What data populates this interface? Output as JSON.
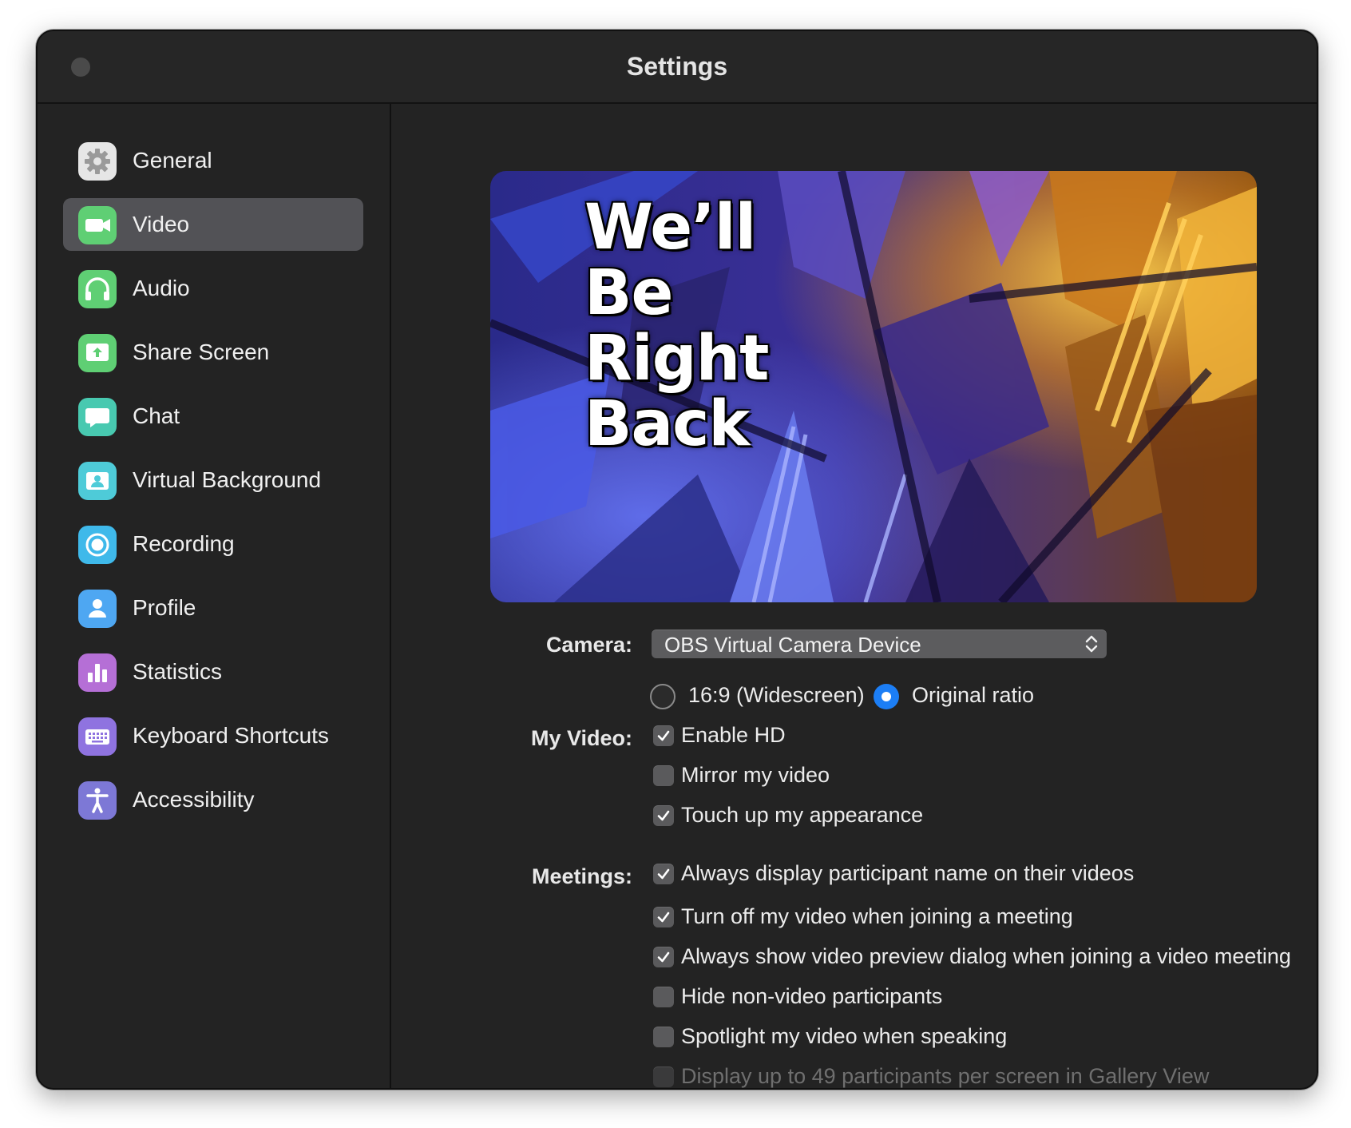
{
  "window": {
    "title": "Settings"
  },
  "sidebar": {
    "items": [
      {
        "label": "General",
        "icon": "gear-icon",
        "color": "#e6e6e6",
        "active": false
      },
      {
        "label": "Video",
        "icon": "video-camera-icon",
        "color": "#5fcf74",
        "active": true
      },
      {
        "label": "Audio",
        "icon": "headphones-icon",
        "color": "#5fcf74",
        "active": false
      },
      {
        "label": "Share Screen",
        "icon": "share-screen-icon",
        "color": "#5fcf74",
        "active": false
      },
      {
        "label": "Chat",
        "icon": "chat-bubble-icon",
        "color": "#48c9b0",
        "active": false
      },
      {
        "label": "Virtual Background",
        "icon": "virtual-background-icon",
        "color": "#4ecbd8",
        "active": false
      },
      {
        "label": "Recording",
        "icon": "record-icon",
        "color": "#3fb9ea",
        "active": false
      },
      {
        "label": "Profile",
        "icon": "profile-icon",
        "color": "#4ea7f2",
        "active": false
      },
      {
        "label": "Statistics",
        "icon": "bar-chart-icon",
        "color": "#b56fd6",
        "active": false
      },
      {
        "label": "Keyboard Shortcuts",
        "icon": "keyboard-icon",
        "color": "#8f73e0",
        "active": false
      },
      {
        "label": "Accessibility",
        "icon": "accessibility-icon",
        "color": "#7d78d6",
        "active": false
      }
    ]
  },
  "video": {
    "preview_text": [
      "We’ll",
      "Be",
      "Right",
      "Back"
    ],
    "camera_label": "Camera:",
    "camera_value": "OBS Virtual Camera Device",
    "ratio_options": [
      {
        "label": "16:9 (Widescreen)",
        "selected": false
      },
      {
        "label": "Original ratio",
        "selected": true
      }
    ],
    "my_video_label": "My Video:",
    "my_video_options": [
      {
        "label": "Enable HD",
        "checked": true,
        "disabled": false
      },
      {
        "label": "Mirror my video",
        "checked": false,
        "disabled": false
      },
      {
        "label": "Touch up my appearance",
        "checked": true,
        "disabled": false
      }
    ],
    "meetings_label": "Meetings:",
    "meetings_options": [
      {
        "label": "Always display participant name on their videos",
        "checked": true,
        "disabled": false
      },
      {
        "label": "Turn off my video when joining a meeting",
        "checked": true,
        "disabled": false
      },
      {
        "label": "Always show video preview dialog when joining a video meeting",
        "checked": true,
        "disabled": false
      },
      {
        "label": "Hide non-video participants",
        "checked": false,
        "disabled": false
      },
      {
        "label": "Spotlight my video when speaking",
        "checked": false,
        "disabled": false
      },
      {
        "label": "Display up to 49 participants per screen in Gallery View",
        "checked": false,
        "disabled": true
      }
    ]
  },
  "colors": {
    "window_bg": "#232323",
    "selection_bg": "#525256",
    "accent_blue": "#1c7ef5"
  }
}
